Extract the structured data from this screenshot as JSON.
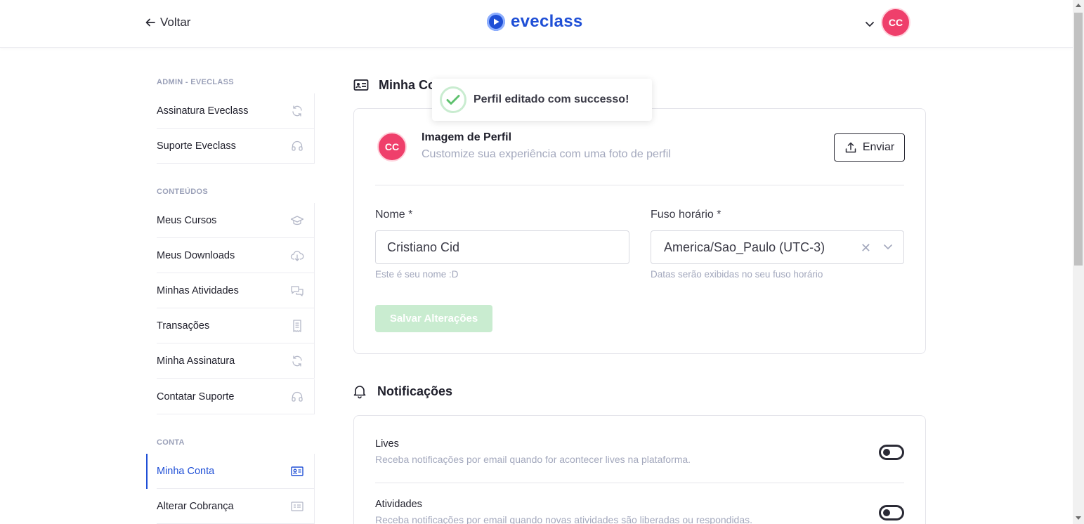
{
  "header": {
    "back_label": "Voltar",
    "logo_text": "eveclass",
    "avatar_initials": "CC",
    "brand_color": "#1f4fd6"
  },
  "sidebar": {
    "sections": [
      {
        "title": "ADMIN - EVECLASS",
        "items": [
          {
            "label": "Assinatura Eveclass",
            "icon": "refresh-icon"
          },
          {
            "label": "Suporte Eveclass",
            "icon": "headset-icon"
          }
        ]
      },
      {
        "title": "CONTEÚDOS",
        "items": [
          {
            "label": "Meus Cursos",
            "icon": "graduation-cap-icon"
          },
          {
            "label": "Meus Downloads",
            "icon": "cloud-download-icon"
          },
          {
            "label": "Minhas Atividades",
            "icon": "chat-bubbles-icon"
          },
          {
            "label": "Transações",
            "icon": "receipt-icon"
          },
          {
            "label": "Minha Assinatura",
            "icon": "refresh-icon"
          },
          {
            "label": "Contatar Suporte",
            "icon": "headset-icon"
          }
        ]
      },
      {
        "title": "CONTA",
        "items": [
          {
            "label": "Minha Conta",
            "icon": "id-card-icon",
            "active": true
          },
          {
            "label": "Alterar Cobrança",
            "icon": "billing-card-icon"
          }
        ]
      }
    ]
  },
  "account": {
    "title": "Minha Conta",
    "profile_image_title": "Imagem de Perfil",
    "profile_image_subtitle": "Customize sua experiência com uma foto de perfil",
    "avatar_initials": "CC",
    "upload_label": "Enviar",
    "name_label": "Nome *",
    "name_value": "Cristiano Cid",
    "name_help": "Este é seu nome :D",
    "timezone_label": "Fuso horário *",
    "timezone_value": "America/Sao_Paulo (UTC-3)",
    "timezone_help": "Datas serão exibidas no seu fuso horário",
    "save_label": "Salvar Alterações"
  },
  "notifications": {
    "title": "Notificações",
    "items": [
      {
        "title": "Lives",
        "description": "Receba notificações por email quando for acontecer lives na plataforma.",
        "enabled": false
      },
      {
        "title": "Atividades",
        "description": "Receba notificações por email quando novas atividades são liberadas ou respondidas.",
        "enabled": false
      }
    ]
  },
  "toast": {
    "message": "Perfil editado com successo!"
  }
}
